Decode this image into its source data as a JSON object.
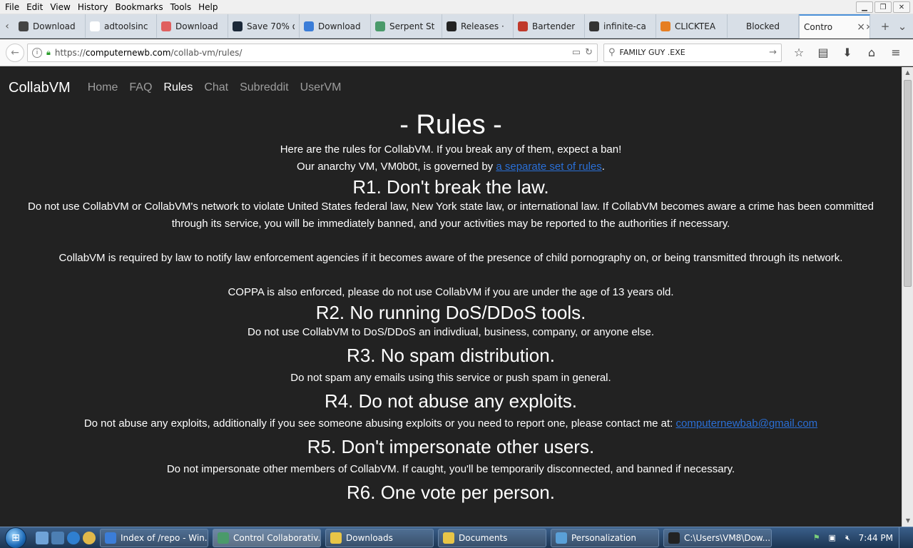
{
  "browser": {
    "menu": [
      "File",
      "Edit",
      "View",
      "History",
      "Bookmarks",
      "Tools",
      "Help"
    ],
    "tabs": [
      {
        "label": "Download",
        "color": "#444444"
      },
      {
        "label": "adtoolsinc",
        "color": "#ffffff"
      },
      {
        "label": "Download",
        "color": "#e06060"
      },
      {
        "label": "Save 70% o",
        "color": "#1b2838"
      },
      {
        "label": "Download",
        "color": "#3b7dd8"
      },
      {
        "label": "Serpent St",
        "color": "#4a9a6a"
      },
      {
        "label": "Releases ·",
        "color": "#222222"
      },
      {
        "label": "Bartender",
        "color": "#c0392b"
      },
      {
        "label": "infinite-ca",
        "color": "#333333"
      },
      {
        "label": "CLICKTEA",
        "color": "#e67e22"
      },
      {
        "label": "Blocked",
        "color": "#d8dfe7"
      }
    ],
    "active_tab": {
      "label": "Contro",
      "close": "×"
    },
    "url_host": "computernewb.com",
    "url_prefix": "https://",
    "url_path": "/collab-vm/rules/",
    "search_value": "FAMILY GUY .EXE"
  },
  "site": {
    "brand": "CollabVM",
    "nav": [
      "Home",
      "FAQ",
      "Rules",
      "Chat",
      "Subreddit",
      "UserVM"
    ],
    "current_nav": "Rules"
  },
  "content": {
    "title": "- Rules -",
    "intro1": "Here are the rules for CollabVM. If you break any of them, expect a ban!",
    "intro2_pre": "Our anarchy VM, VM0b0t, is governed by ",
    "intro2_link": "a separate set of rules",
    "intro2_post": ".",
    "r1_title": "R1. Don't break the law.",
    "r1_p1": "Do not use CollabVM or CollabVM's network to violate United States federal law, New York state law, or international law. If CollabVM becomes aware a crime has been committed through its service, you will be immediately banned, and your activities may be reported to the authorities if necessary.",
    "r1_p2": "CollabVM is required by law to notify law enforcement agencies if it becomes aware of the presence of child pornography on, or being transmitted through its network.",
    "r1_p3": "COPPA is also enforced, please do not use CollabVM if you are under the age of 13 years old.",
    "r2_title": "R2. No running DoS/DDoS tools.",
    "r2_p": "Do not use CollabVM to DoS/DDoS an indivdiual, business, company, or anyone else.",
    "r3_title": "R3. No spam distribution.",
    "r3_p": "Do not spam any emails using this service or push spam in general.",
    "r4_title": "R4. Do not abuse any exploits.",
    "r4_p": "Do not abuse any exploits, additionally if you see someone abusing exploits or you need to report one, please contact me at: ",
    "r4_email": "computernewbab@gmail.com",
    "r5_title": "R5. Don't impersonate other users.",
    "r5_p": "Do not impersonate other members of CollabVM. If caught, you'll be temporarily disconnected, and banned if necessary.",
    "r6_title": "R6. One vote per person."
  },
  "taskbar": {
    "items": [
      {
        "label": "Index of /repo - Win...",
        "color": "#3b7dd8"
      },
      {
        "label": "Control Collaborativ...",
        "color": "#4a9a6a"
      },
      {
        "label": "Downloads",
        "color": "#e8c547"
      },
      {
        "label": "Documents",
        "color": "#e8c547"
      },
      {
        "label": "Personalization",
        "color": "#5aa0d8"
      },
      {
        "label": "C:\\Users\\VM8\\Dow...",
        "color": "#222222"
      }
    ],
    "clock": "7:44 PM"
  }
}
